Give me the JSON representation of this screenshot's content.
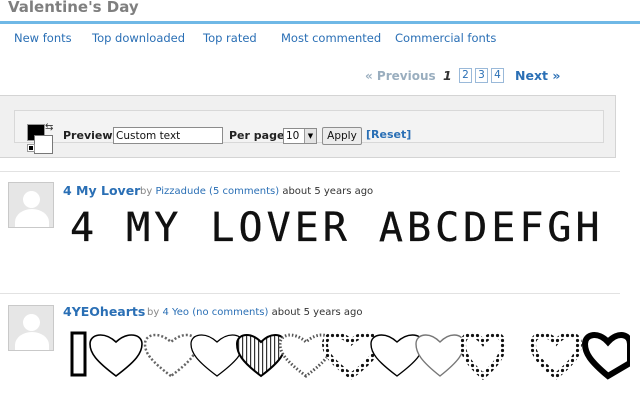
{
  "page": {
    "title": "Valentine's Day"
  },
  "nav": [
    {
      "label": "New fonts"
    },
    {
      "label": "Top downloaded"
    },
    {
      "label": "Top rated"
    },
    {
      "label": "Most commented"
    },
    {
      "label": "Commercial fonts"
    }
  ],
  "pager": {
    "previous": "« Previous",
    "current": "1",
    "pages": [
      "2",
      "3",
      "4"
    ],
    "next": "Next »"
  },
  "preview": {
    "label": "Preview:",
    "value": "Custom text",
    "per_page_label": "Per page:",
    "per_page_value": "10",
    "apply": "Apply",
    "reset": "[Reset]",
    "fg_color": "#000000",
    "bg_color": "#ffffff"
  },
  "fonts": [
    {
      "name": "4 My Lover",
      "by": "by",
      "author": "Pizzadude",
      "comments": "(5 comments)",
      "ago": "about 5 years ago",
      "sample": "4 MY LOVER ABCDEFGH"
    },
    {
      "name": "4YEOhearts",
      "by": "by",
      "author": "4 Yeo",
      "comments": "(no comments)",
      "ago": "about 5 years ago"
    }
  ],
  "colors": {
    "link": "#2a6fb5",
    "title_rule": "#6fb8e6",
    "title": "#7f7f7f"
  }
}
